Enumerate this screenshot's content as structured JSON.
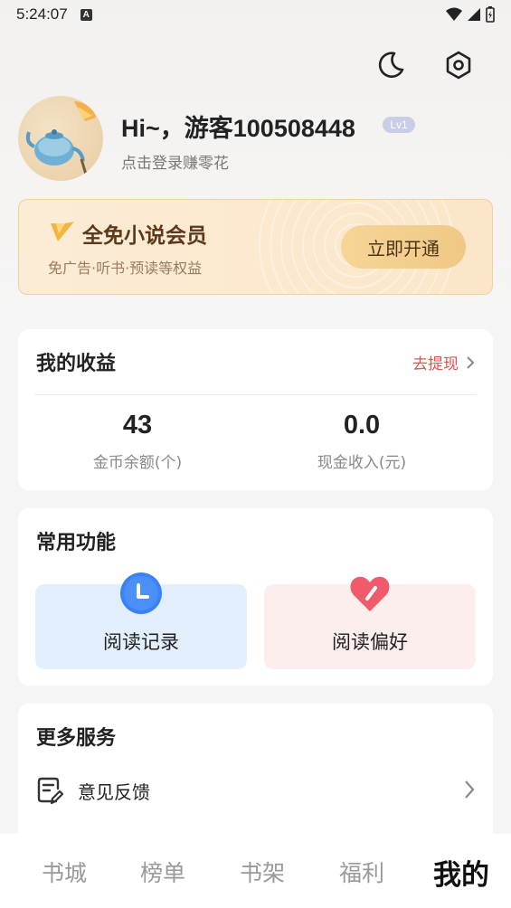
{
  "status_bar": {
    "time": "5:24:07",
    "notification_badge": "A"
  },
  "header": {
    "greeting": "Hi~，游客100508448",
    "level": "Lv1",
    "login_hint": "点击登录赚零花",
    "icons": [
      "moon-icon",
      "gear-icon"
    ]
  },
  "vip": {
    "title": "全免小说会员",
    "subtitle": "免广告·听书·预读等权益",
    "button": "立即开通"
  },
  "earnings": {
    "title": "我的收益",
    "withdraw": "去提现",
    "coins_value": "43",
    "coins_label": "金币余额(个)",
    "cash_value": "0.0",
    "cash_label": "现金收入(元)"
  },
  "functions": {
    "title": "常用功能",
    "items": [
      {
        "label": "阅读记录",
        "icon": "clock-icon"
      },
      {
        "label": "阅读偏好",
        "icon": "heart-icon"
      }
    ]
  },
  "more": {
    "title": "更多服务",
    "items": [
      {
        "label": "意见反馈",
        "icon": "feedback-icon"
      }
    ]
  },
  "tabs": [
    {
      "label": "书城",
      "active": false
    },
    {
      "label": "榜单",
      "active": false
    },
    {
      "label": "书架",
      "active": false
    },
    {
      "label": "福利",
      "active": false
    },
    {
      "label": "我的",
      "active": true
    }
  ],
  "colors": {
    "accent_red": "#e25252",
    "vip_gold": "#f0c886",
    "clock_blue": "#3b82f6",
    "heart_red": "#f05a6a"
  }
}
